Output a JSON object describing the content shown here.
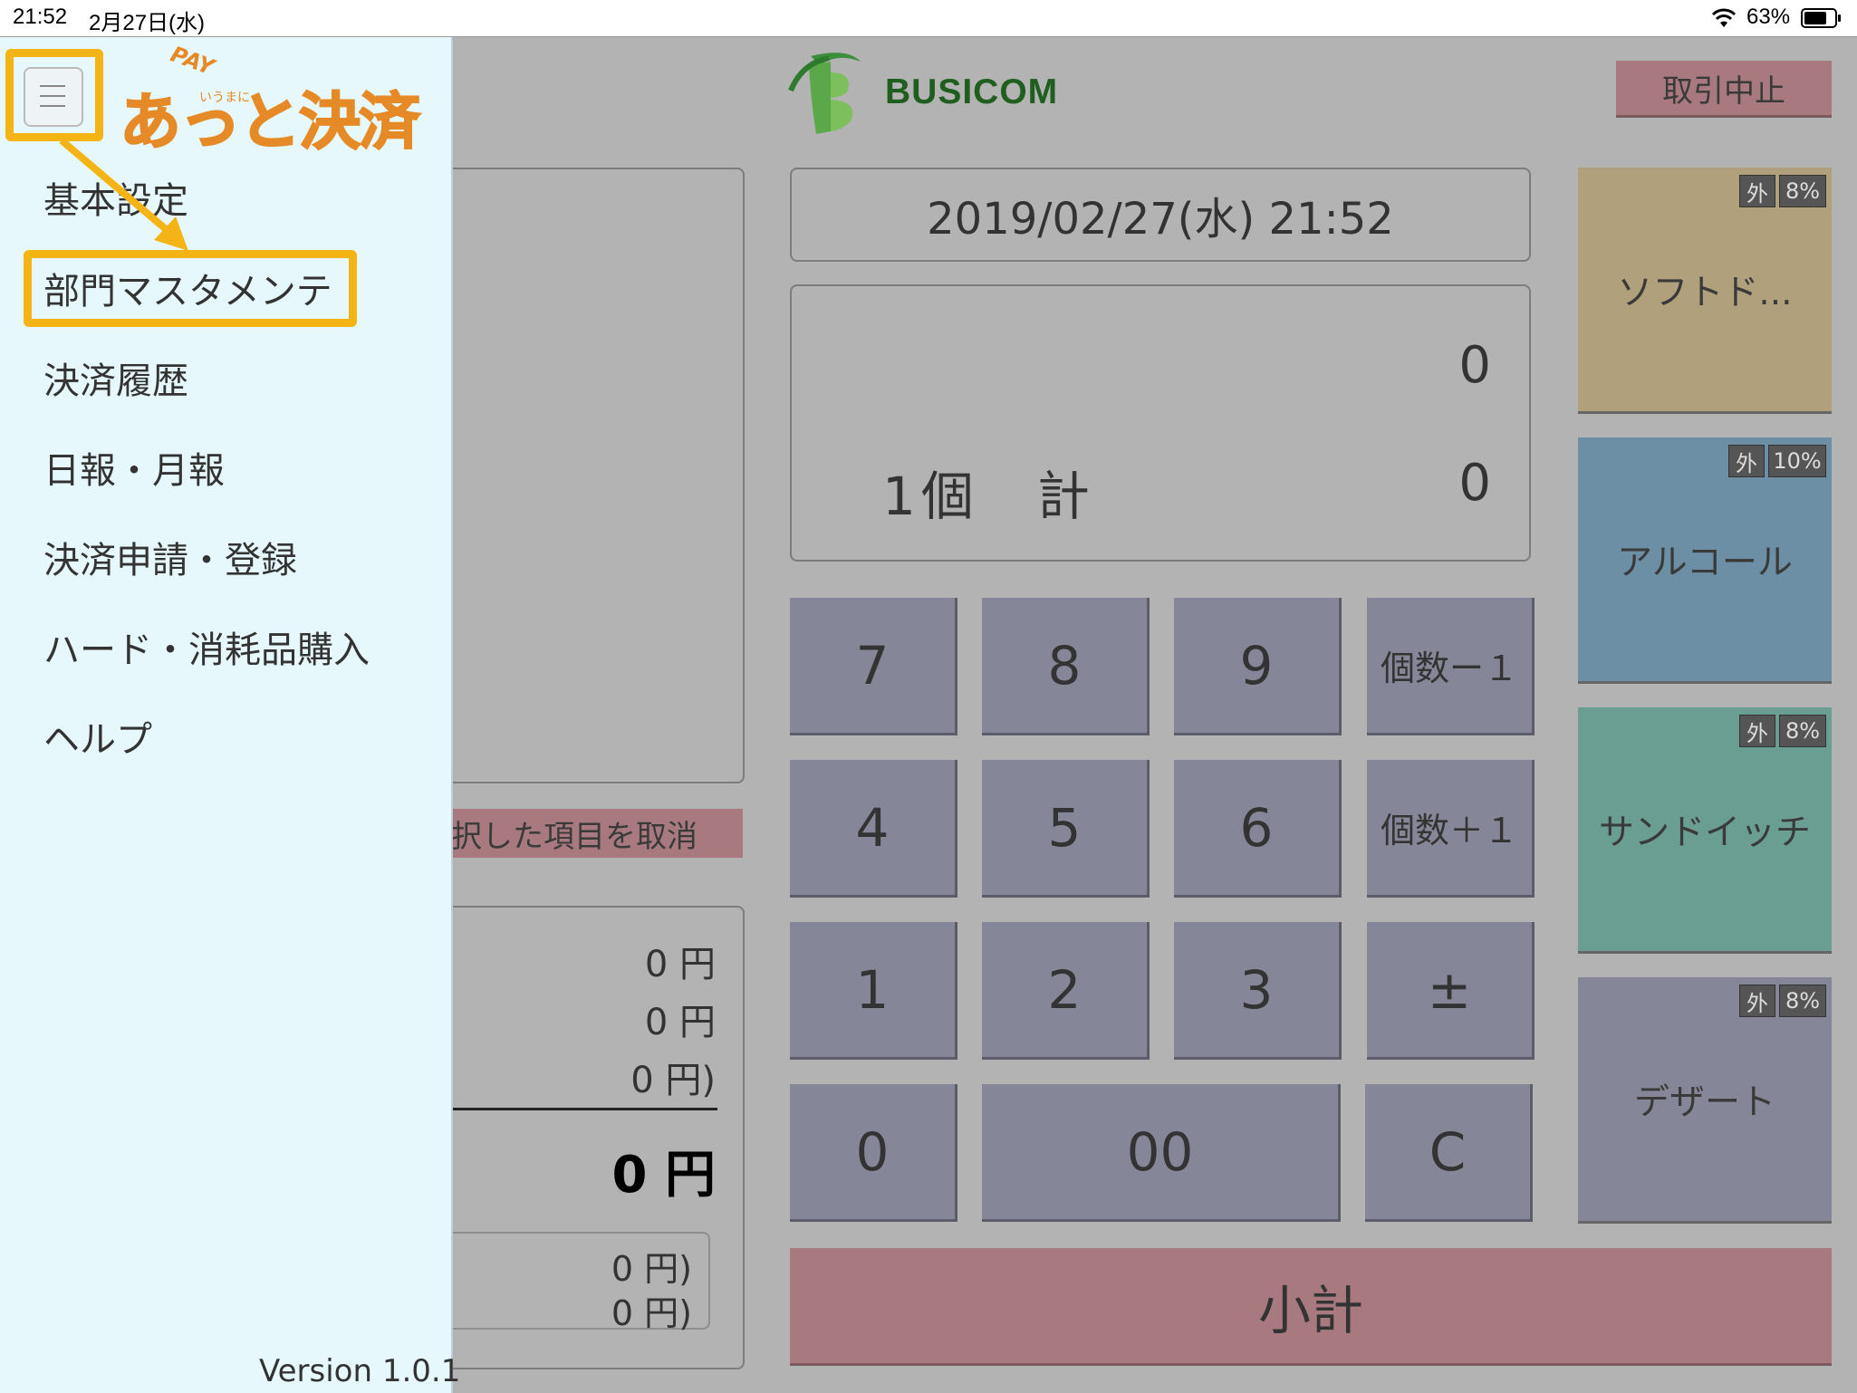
{
  "status_bar": {
    "time": "21:52",
    "date": "2月27日(水)",
    "battery": "63%"
  },
  "header": {
    "brand": "BUSICOM",
    "cancel_transaction": "取引中止"
  },
  "left_panel": {
    "cancel_selected": "択した項目を取消"
  },
  "totals": {
    "rows": [
      "0 円",
      "0 円",
      "0 円)"
    ],
    "total": "0 円",
    "sub_rows": [
      "0 円)",
      "0 円)"
    ]
  },
  "display": {
    "datetime": "2019/02/27(水) 21:52",
    "current_value": "0",
    "count_label": "1個　計",
    "sum_value": "0"
  },
  "keypad": {
    "k7": "7",
    "k8": "8",
    "k9": "9",
    "qty_minus": "個数ー１",
    "k4": "4",
    "k5": "5",
    "k6": "6",
    "qty_plus": "個数＋１",
    "k1": "1",
    "k2": "2",
    "k3": "3",
    "plus_minus": "±",
    "k0": "0",
    "k00": "00",
    "clear": "C",
    "subtotal": "小計"
  },
  "departments": [
    {
      "name": "ソフトド...",
      "tax_type": "外",
      "rate": "8%",
      "color": "#b0a07c"
    },
    {
      "name": "アルコール",
      "tax_type": "外",
      "rate": "10%",
      "color": "#6d8fa6"
    },
    {
      "name": "サンドイッチ",
      "tax_type": "外",
      "rate": "8%",
      "color": "#6a9e93"
    },
    {
      "name": "デザート",
      "tax_type": "外",
      "rate": "8%",
      "color": "#868699"
    }
  ],
  "drawer": {
    "app_name": "あっと決済",
    "app_superscript_pay": "PAY",
    "app_superscript_small": "いうまに",
    "menu": [
      "基本設定",
      "部門マスタメンテ",
      "決済履歴",
      "日報・月報",
      "決済申請・登録",
      "ハード・消耗品購入",
      "ヘルプ"
    ],
    "version": "Version 1.0.1"
  },
  "colors": {
    "highlight": "#f5b416",
    "logo_orange": "#e58a26",
    "drawer_bg": "#e7f8fc"
  }
}
